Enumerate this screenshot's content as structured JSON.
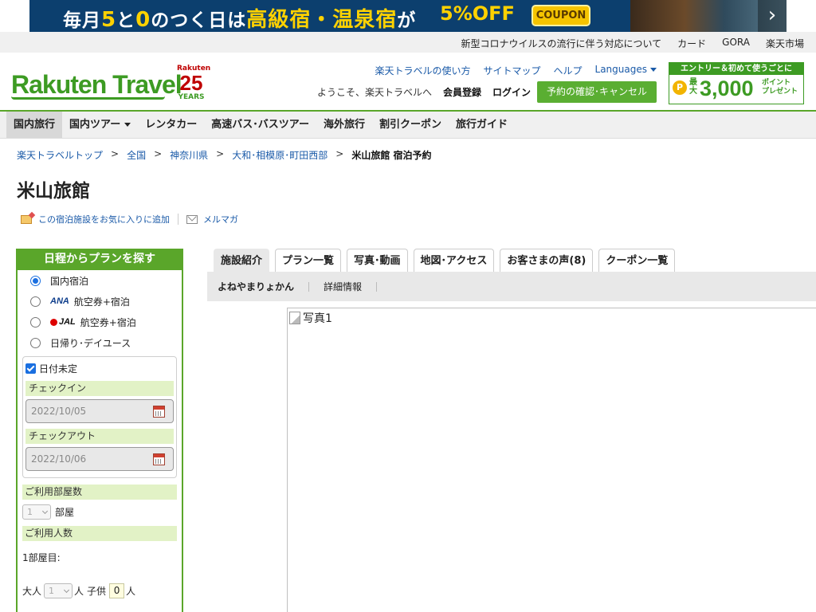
{
  "banner": {
    "text_a": "毎月",
    "text_b": "5",
    "text_c": "と",
    "text_d": "0",
    "text_e": "のつく日は",
    "text_f": "高級宿・温泉宿",
    "text_g": "が",
    "text_off": "5%OFF",
    "coupon_label": "COUPON"
  },
  "util_links": [
    "新型コロナウイルスの流行に伴う対応について",
    "カード",
    "GORA",
    "楽天市場"
  ],
  "header": {
    "logo": "Rakuten Travel",
    "years_top": "Rakuten",
    "years_num": "25",
    "years_bottom": "YEARS",
    "links": [
      "楽天トラベルの使い方",
      "サイトマップ",
      "ヘルプ"
    ],
    "languages": "Languages",
    "welcome": "ようこそ、楽天トラベルへ",
    "register": "会員登録",
    "login": "ログイン",
    "reserve_button": "予約の確認･キャンセル",
    "promo": {
      "top": "エントリー＆初めて使うごとに",
      "coin": "P",
      "max": "最大",
      "amount": "3,000",
      "points": "ポイント",
      "present": "プレゼント"
    }
  },
  "nav": {
    "items": [
      "国内旅行",
      "国内ツアー",
      "レンタカー",
      "高速バス･バスツアー",
      "海外旅行",
      "割引クーポン",
      "旅行ガイド"
    ]
  },
  "breadcrumb": {
    "items": [
      "楽天トラベルトップ",
      "全国",
      "神奈川県",
      "大和･相模原･町田西部"
    ],
    "current": "米山旅館 宿泊予約",
    "separator": ">"
  },
  "page_title": "米山旅館",
  "actions": {
    "favorite": "この宿泊施設をお気に入りに追加",
    "mailmag": "メルマガ"
  },
  "sidebar": {
    "title": "日程からプランを探す",
    "radios": [
      {
        "label": "国内宿泊",
        "selected": true
      },
      {
        "logo": "ANA",
        "label": "航空券+宿泊"
      },
      {
        "logo": "JAL",
        "label": "航空券+宿泊"
      },
      {
        "label": "日帰り･デイユース"
      }
    ],
    "undecided": "日付未定",
    "checkin_label": "チェックイン",
    "checkin_value": "2022/10/05",
    "checkout_label": "チェックアウト",
    "checkout_value": "2022/10/06",
    "rooms_label": "ご利用部屋数",
    "rooms_value": "1",
    "rooms_unit": "部屋",
    "people_label": "ご利用人数",
    "room_no": "1部屋目:",
    "adult_label": "大人",
    "adult_value": "1",
    "person_unit": "人",
    "child_label": "子供",
    "child_value": "0"
  },
  "tabs": [
    "施設紹介",
    "プラン一覧",
    "写真･動画",
    "地図･アクセス",
    "お客さまの声(8)",
    "クーポン一覧"
  ],
  "subbar": {
    "reading": "よねやまりょかん",
    "details": "詳細情報"
  },
  "photo_alt": "写真1",
  "colors": {
    "brand_green": "#5aa62a",
    "link_blue": "#1a5aa8",
    "banner_navy": "#0c3f6e",
    "years_red": "#bf0000"
  }
}
